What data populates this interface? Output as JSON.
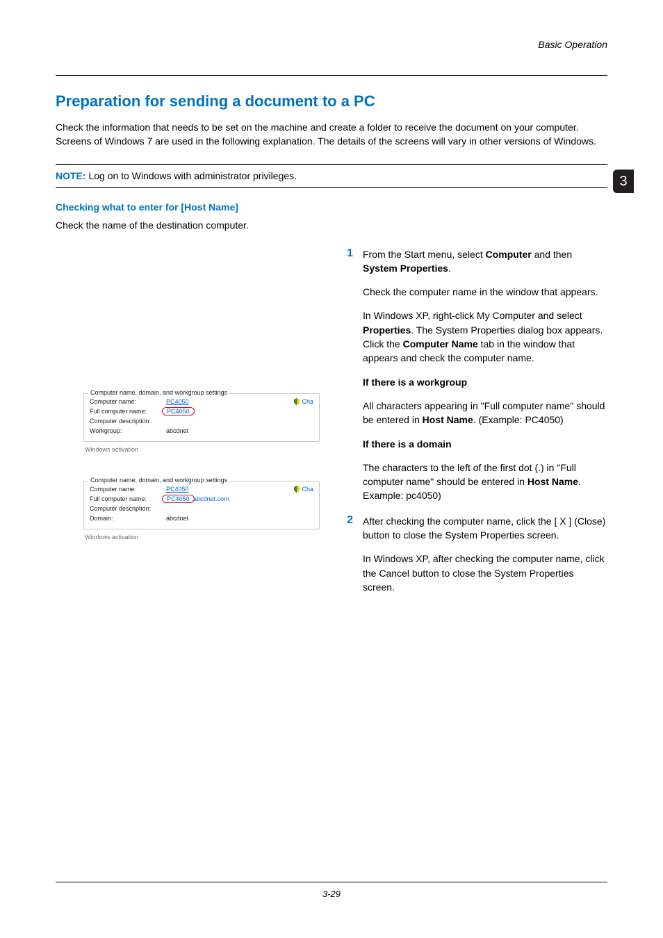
{
  "running_head": "Basic Operation",
  "chapter_tab": "3",
  "h1": "Preparation for sending a document to a PC",
  "intro": "Check the information that needs to be set on the machine and create a folder to receive the document on your computer. Screens of Windows 7 are used in the following explanation. The details of the screens will vary in other versions of Windows.",
  "note_label": "NOTE:",
  "note_text": " Log on to Windows with administrator privileges.",
  "h2": "Checking what to enter for [Host Name]",
  "h2_sub": "Check the name of the destination computer.",
  "steps": {
    "s1": {
      "num": "1",
      "p1a": "From the Start menu, select ",
      "p1b_bold": "Computer",
      "p1c": " and then ",
      "p1d_bold": "System Properties",
      "p1e": ".",
      "p2": "Check the computer name in the window that appears.",
      "p3a": "In Windows XP, right-click My Computer and select ",
      "p3b_bold": "Properties",
      "p3c": ". The System Properties dialog box appears. Click the ",
      "p3d_bold": "Computer Name",
      "p3e": " tab in the window that appears and check the computer name.",
      "wg_head": "If there is a workgroup",
      "wg_a": "All characters appearing in \"Full computer name\" should be entered in ",
      "wg_b_bold": "Host Name",
      "wg_c": ". (Example: PC4050)",
      "dom_head": "If there is a domain",
      "dom_a": "The characters to the left of the first dot (.) in \"Full computer name\" should be entered in ",
      "dom_b_bold": "Host Name",
      "dom_c": ". Example: pc4050)"
    },
    "s2": {
      "num": "2",
      "p1": "After checking the computer name, click the [ X ] (Close) button to close the System Properties screen.",
      "p2": "In Windows XP, after checking the computer name, click the Cancel button to close the System Properties screen."
    }
  },
  "win": {
    "legend": "Computer name, domain, and workgroup settings",
    "row_computer": "Computer name:",
    "row_full": "Full computer name:",
    "row_desc": "Computer description:",
    "row_workgroup": "Workgroup:",
    "row_domain": "Domain:",
    "val_pc": "PC4050",
    "val_pc_circled": "PC4050",
    "val_full_domain": ".abcdnet.com",
    "val_abcdnet": "abcdnet",
    "change": "Cha",
    "activation": "Windows activation"
  },
  "page_number": "3-29"
}
